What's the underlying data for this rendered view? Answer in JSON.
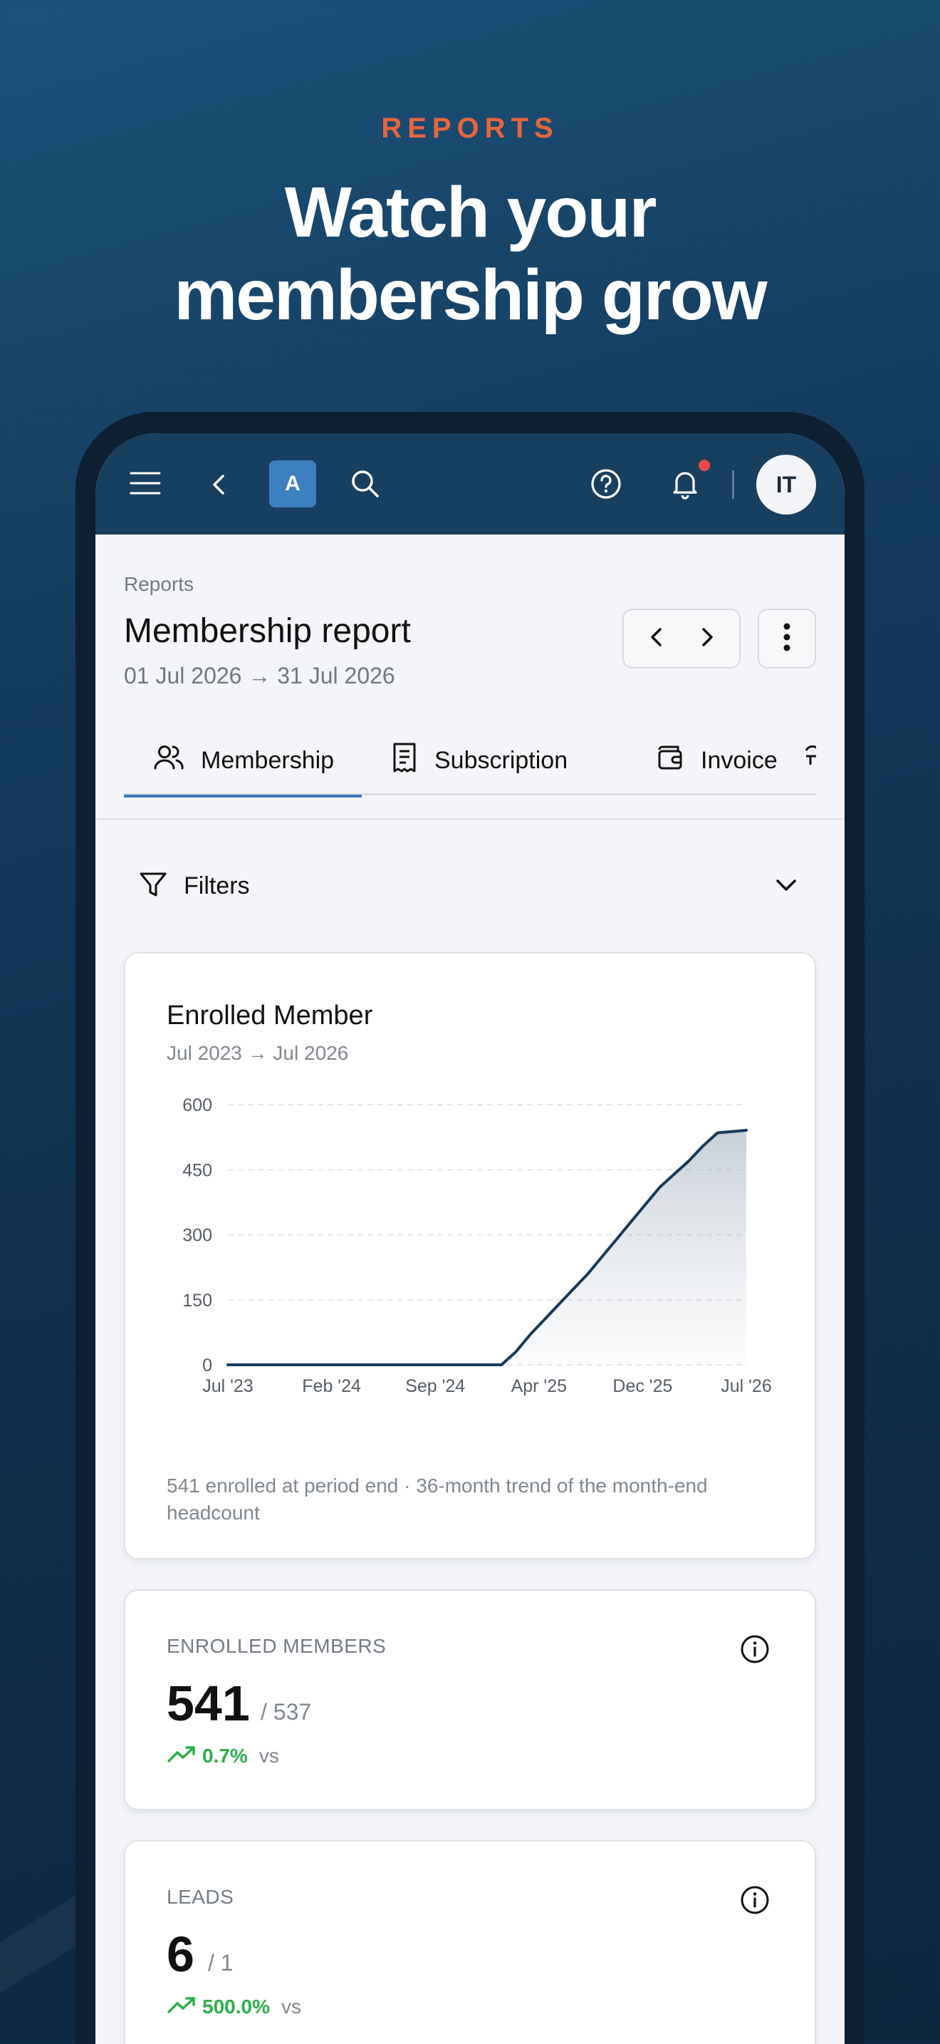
{
  "promo": {
    "eyebrow": "REPORTS",
    "title_line1": "Watch your",
    "title_line2": "membership grow"
  },
  "appbar": {
    "badge": "A",
    "avatar_initials": "IT",
    "icons": [
      "menu-icon",
      "back-icon",
      "search-icon",
      "help-icon",
      "bell-icon"
    ],
    "notification_dot_color": "#e84a4a"
  },
  "header": {
    "breadcrumb": "Reports",
    "title": "Membership report",
    "date_range": "01 Jul 2026 → 31 Jul 2026"
  },
  "tabs": [
    {
      "label": "Membership",
      "icon": "users-icon",
      "active": true
    },
    {
      "label": "Subscription",
      "icon": "receipt-icon",
      "active": false
    },
    {
      "label": "Invoice",
      "icon": "wallet-icon",
      "active": false
    }
  ],
  "filters": {
    "label": "Filters"
  },
  "chart_card": {
    "title": "Enrolled Member",
    "range": "Jul 2023 → Jul 2026",
    "caption": "541 enrolled at period end · 36-month trend of the month-end headcount"
  },
  "chart_data": {
    "type": "area",
    "title": "Enrolled Member",
    "subtitle": "Jul 2023 → Jul 2026",
    "x_tick_labels": [
      "Jul '23",
      "Feb '24",
      "Sep '24",
      "Apr '25",
      "Dec '25",
      "Jul '26"
    ],
    "y_ticks": [
      0,
      150,
      300,
      450,
      600
    ],
    "ylim": [
      0,
      600
    ],
    "grid": true,
    "x_range": [
      "2023-07",
      "2026-07"
    ],
    "series": [
      {
        "x": [
          "2023-07",
          "2023-08",
          "2023-09",
          "2023-10",
          "2023-11",
          "2023-12",
          "2024-01",
          "2024-02",
          "2024-03",
          "2024-04",
          "2024-05",
          "2024-06",
          "2024-07",
          "2024-08",
          "2024-09",
          "2024-10",
          "2024-11",
          "2024-12",
          "2025-01",
          "2025-02",
          "2025-03",
          "2025-04",
          "2025-05",
          "2025-06",
          "2025-07",
          "2025-08",
          "2025-09",
          "2025-10",
          "2025-11",
          "2025-12",
          "2026-01",
          "2026-02",
          "2026-03",
          "2026-04",
          "2026-05",
          "2026-06",
          "2026-07"
        ],
        "values": [
          0,
          0,
          0,
          0,
          0,
          0,
          0,
          0,
          0,
          0,
          0,
          0,
          0,
          0,
          0,
          0,
          0,
          0,
          0,
          0,
          30,
          70,
          105,
          140,
          175,
          210,
          250,
          290,
          330,
          370,
          410,
          440,
          470,
          505,
          535,
          538,
          541
        ]
      }
    ],
    "line_color": "#173a5a"
  },
  "stats": [
    {
      "label": "ENROLLED MEMBERS",
      "value": "541",
      "target": "/ 537",
      "change": "0.7%",
      "vs": "vs"
    },
    {
      "label": "LEADS",
      "value": "6",
      "target": "/ 1",
      "change": "500.0%",
      "vs": "vs"
    }
  ]
}
